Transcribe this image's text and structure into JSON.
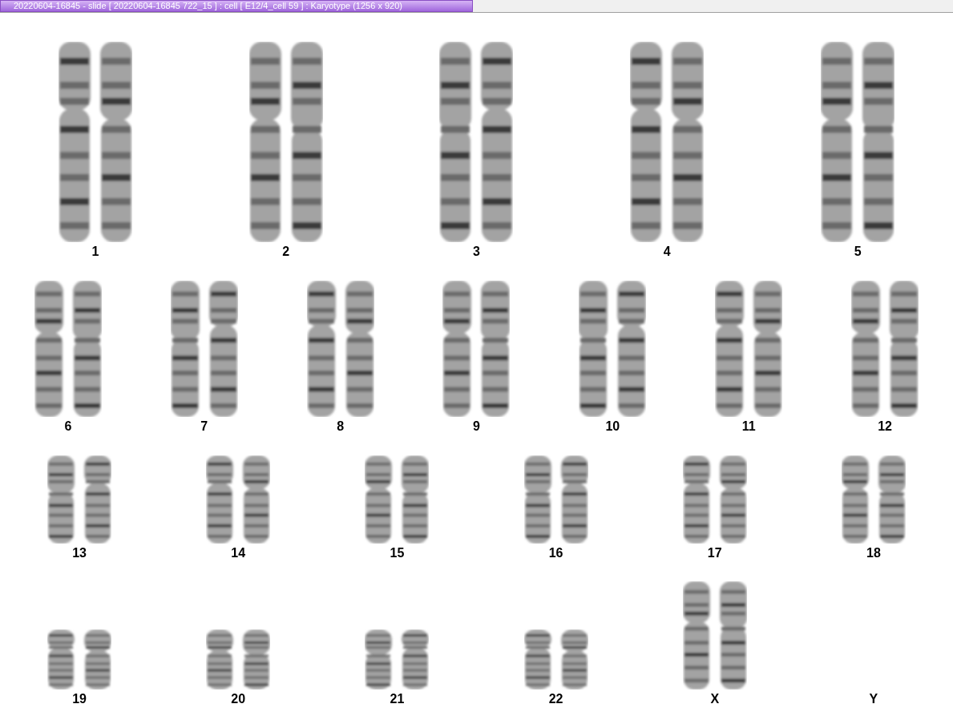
{
  "window": {
    "title": "20220604-16845 - slide [ 20220604-16845 722_15 ] : cell [ E12/4_cell 59 ] : Karyotype  (1256 x 920)"
  },
  "karyotype": {
    "rows": [
      {
        "items": [
          {
            "label": "1",
            "kind": "pair"
          },
          {
            "label": "2",
            "kind": "pair"
          },
          {
            "label": "3",
            "kind": "pair"
          },
          {
            "label": "4",
            "kind": "pair"
          },
          {
            "label": "5",
            "kind": "pair"
          }
        ]
      },
      {
        "items": [
          {
            "label": "6",
            "kind": "pair"
          },
          {
            "label": "7",
            "kind": "pair"
          },
          {
            "label": "8",
            "kind": "pair"
          },
          {
            "label": "9",
            "kind": "pair"
          },
          {
            "label": "10",
            "kind": "pair"
          },
          {
            "label": "11",
            "kind": "pair"
          },
          {
            "label": "12",
            "kind": "pair"
          }
        ]
      },
      {
        "items": [
          {
            "label": "13",
            "kind": "pair"
          },
          {
            "label": "14",
            "kind": "pair"
          },
          {
            "label": "15",
            "kind": "pair"
          },
          {
            "label": "16",
            "kind": "pair"
          },
          {
            "label": "17",
            "kind": "pair"
          },
          {
            "label": "18",
            "kind": "pair"
          }
        ]
      },
      {
        "items": [
          {
            "label": "19",
            "kind": "pair"
          },
          {
            "label": "20",
            "kind": "pair"
          },
          {
            "label": "21",
            "kind": "pair"
          },
          {
            "label": "22",
            "kind": "pair"
          },
          {
            "label": "X",
            "kind": "large-pair"
          },
          {
            "label": "Y",
            "kind": "empty"
          }
        ]
      }
    ]
  }
}
